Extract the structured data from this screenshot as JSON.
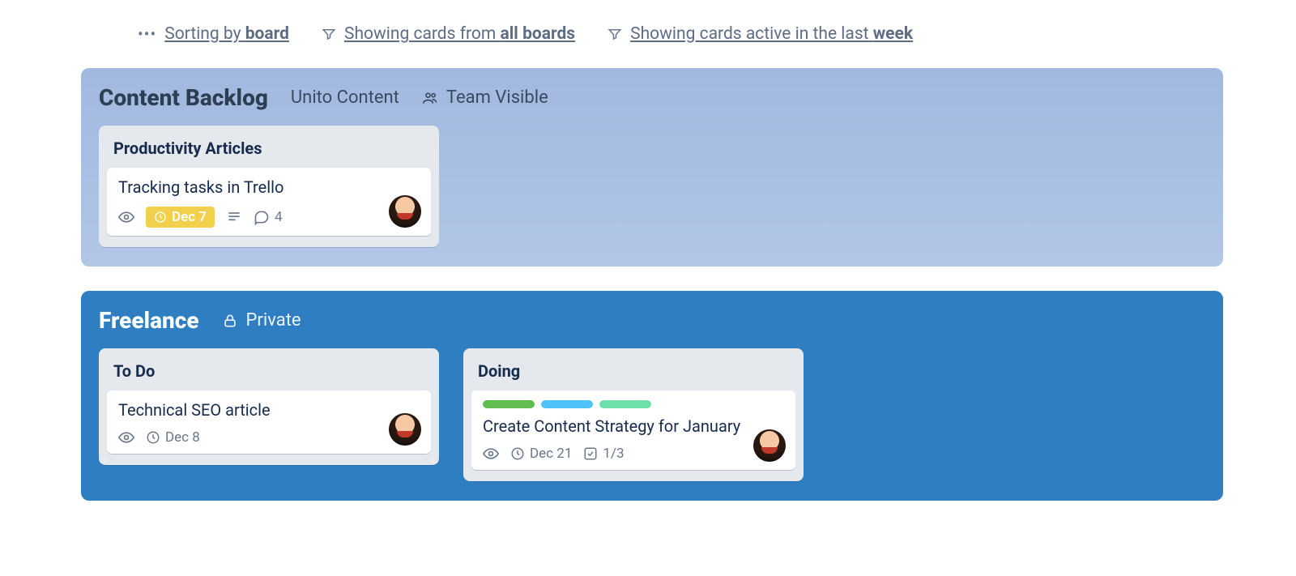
{
  "filters": {
    "sort_prefix": "Sorting by ",
    "sort_bold": "board",
    "cards_prefix": "Showing cards from ",
    "cards_bold": "all boards",
    "active_prefix": "Showing cards active in the last ",
    "active_bold": "week"
  },
  "boards": [
    {
      "title": "Content Backlog",
      "team": "Unito Content",
      "visibility": "Team Visible",
      "theme": "sky",
      "lists": [
        {
          "title": "Productivity Articles",
          "cards": [
            {
              "title": "Tracking tasks in Trello",
              "watch": true,
              "due": "Dec 7",
              "due_highlight": true,
              "description": true,
              "comments": "4",
              "checklist": null,
              "labels": []
            }
          ]
        }
      ]
    },
    {
      "title": "Freelance",
      "team": null,
      "visibility": "Private",
      "theme": "blue",
      "lists": [
        {
          "title": "To Do",
          "cards": [
            {
              "title": "Technical SEO article",
              "watch": true,
              "due": "Dec 8",
              "due_highlight": false,
              "description": false,
              "comments": null,
              "checklist": null,
              "labels": []
            }
          ]
        },
        {
          "title": "Doing",
          "cards": [
            {
              "title": "Create Content Strategy for January",
              "watch": true,
              "due": "Dec 21",
              "due_highlight": false,
              "description": false,
              "comments": null,
              "checklist": "1/3",
              "labels": [
                "#61bd4f",
                "#4fc3f7",
                "#6ddfa8"
              ]
            }
          ]
        }
      ]
    }
  ]
}
